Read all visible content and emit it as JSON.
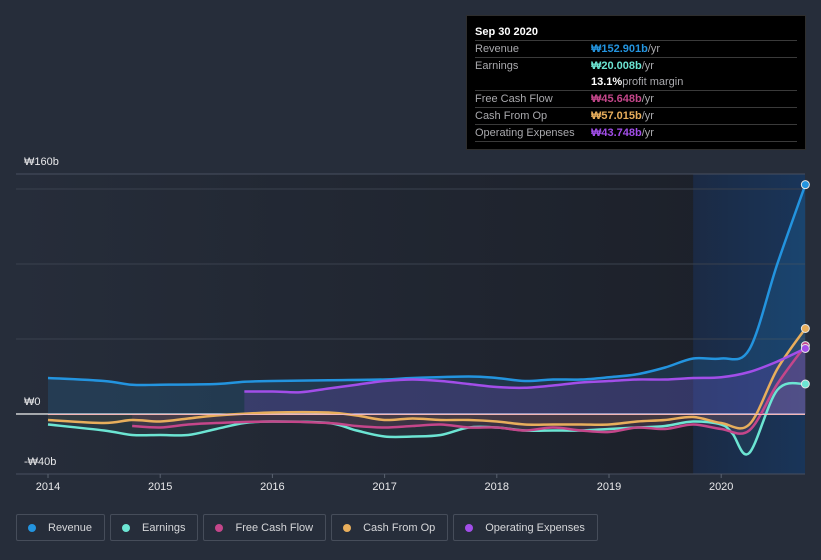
{
  "tooltip": {
    "date": "Sep 30 2020",
    "rows": [
      {
        "label": "Revenue",
        "value": "₩152.901b",
        "unit": " /yr",
        "color": "#2394df"
      },
      {
        "label": "Earnings",
        "value": "₩20.008b",
        "unit": " /yr",
        "color": "#6ce5d3"
      },
      {
        "label": "",
        "value": "13.1%",
        "unit": " profit margin",
        "color": "#ffffff"
      },
      {
        "label": "Free Cash Flow",
        "value": "₩45.648b",
        "unit": " /yr",
        "color": "#c4468a"
      },
      {
        "label": "Cash From Op",
        "value": "₩57.015b",
        "unit": " /yr",
        "color": "#e8ae5c"
      },
      {
        "label": "Operating Expenses",
        "value": "₩43.748b",
        "unit": " /yr",
        "color": "#a24ee9"
      }
    ]
  },
  "legend": [
    {
      "label": "Revenue",
      "color": "#2394df"
    },
    {
      "label": "Earnings",
      "color": "#6ce5d3"
    },
    {
      "label": "Free Cash Flow",
      "color": "#c4468a"
    },
    {
      "label": "Cash From Op",
      "color": "#e8ae5c"
    },
    {
      "label": "Operating Expenses",
      "color": "#a24ee9"
    }
  ],
  "chart_data": {
    "type": "line",
    "title": "",
    "xlabel": "",
    "ylabel": "",
    "ylim": [
      -40,
      160
    ],
    "xlim": [
      2014,
      2020.75
    ],
    "y_ticks": [
      {
        "value": 160,
        "label": "₩160b"
      },
      {
        "value": 0,
        "label": "₩0"
      },
      {
        "value": -40,
        "label": "-₩40b"
      }
    ],
    "y_gridlines": [
      150,
      100,
      50,
      0
    ],
    "x_ticks": [
      {
        "value": 2014,
        "label": "2014"
      },
      {
        "value": 2015,
        "label": "2015"
      },
      {
        "value": 2016,
        "label": "2016"
      },
      {
        "value": 2017,
        "label": "2017"
      },
      {
        "value": 2018,
        "label": "2018"
      },
      {
        "value": 2019,
        "label": "2019"
      },
      {
        "value": 2020,
        "label": "2020"
      }
    ],
    "highlight_start": 2019.75,
    "grid": true,
    "legend_position": "bottom",
    "units": "KRW billions",
    "series": [
      {
        "name": "Revenue",
        "color": "#2394df",
        "x": [
          2014,
          2014.5,
          2014.75,
          2015,
          2015.5,
          2015.75,
          2016,
          2016.5,
          2017,
          2017.25,
          2017.75,
          2018,
          2018.25,
          2018.5,
          2018.75,
          2019,
          2019.25,
          2019.5,
          2019.75,
          2020,
          2020.25,
          2020.5,
          2020.75
        ],
        "values": [
          24,
          22,
          19.5,
          19.5,
          20,
          21.5,
          22,
          22.5,
          23,
          24,
          25,
          24,
          22,
          23,
          23,
          24.5,
          26.5,
          31,
          37,
          37,
          43,
          100,
          152.9
        ]
      },
      {
        "name": "Earnings",
        "color": "#6ce5d3",
        "x": [
          2014,
          2014.5,
          2014.75,
          2015,
          2015.25,
          2015.5,
          2015.75,
          2016,
          2016.5,
          2016.75,
          2017,
          2017.25,
          2017.5,
          2017.75,
          2018,
          2018.25,
          2018.5,
          2018.75,
          2019,
          2019.25,
          2019.5,
          2019.75,
          2020,
          2020.1,
          2020.25,
          2020.5,
          2020.75
        ],
        "values": [
          -7,
          -11,
          -14,
          -14,
          -14,
          -10,
          -6,
          -5,
          -6,
          -11,
          -15,
          -15,
          -14,
          -9,
          -9,
          -11,
          -11,
          -11,
          -10,
          -9,
          -8,
          -5,
          -7,
          -13,
          -26,
          16,
          20
        ]
      },
      {
        "name": "Free Cash Flow",
        "color": "#c4468a",
        "x": [
          2014.75,
          2015,
          2015.25,
          2015.5,
          2016,
          2016.5,
          2016.75,
          2017,
          2017.25,
          2017.5,
          2017.75,
          2018,
          2018.25,
          2018.5,
          2018.75,
          2019,
          2019.25,
          2019.5,
          2019.75,
          2020,
          2020.25,
          2020.5,
          2020.75
        ],
        "values": [
          -8,
          -9,
          -7,
          -6,
          -5,
          -6,
          -8,
          -9,
          -8,
          -7,
          -9,
          -9,
          -11,
          -9,
          -11,
          -12,
          -9,
          -10,
          -7,
          -10,
          -11,
          20,
          45.6
        ]
      },
      {
        "name": "Cash From Op",
        "color": "#e8ae5c",
        "x": [
          2014,
          2014.5,
          2014.75,
          2015,
          2015.25,
          2015.5,
          2016,
          2016.5,
          2016.75,
          2017,
          2017.25,
          2017.5,
          2017.75,
          2018,
          2018.25,
          2018.5,
          2018.75,
          2019,
          2019.25,
          2019.5,
          2019.75,
          2020,
          2020.25,
          2020.5,
          2020.75
        ],
        "values": [
          -4,
          -6,
          -4,
          -5,
          -3,
          -1,
          1,
          1,
          -1,
          -4,
          -3,
          -4,
          -4,
          -5,
          -7,
          -7,
          -7,
          -7,
          -5,
          -4,
          -2,
          -6,
          -7,
          30,
          57
        ]
      },
      {
        "name": "Operating Expenses",
        "color": "#a24ee9",
        "x": [
          2015.75,
          2016,
          2016.25,
          2016.5,
          2016.75,
          2017,
          2017.25,
          2017.5,
          2017.75,
          2018,
          2018.25,
          2018.5,
          2018.75,
          2019,
          2019.25,
          2019.5,
          2019.75,
          2020,
          2020.25,
          2020.5,
          2020.75
        ],
        "values": [
          15,
          15,
          14.5,
          17,
          19.5,
          22,
          23,
          22,
          20,
          18,
          17.5,
          19,
          21,
          22,
          23,
          23,
          24,
          24.5,
          28,
          35,
          43.7
        ]
      }
    ]
  }
}
